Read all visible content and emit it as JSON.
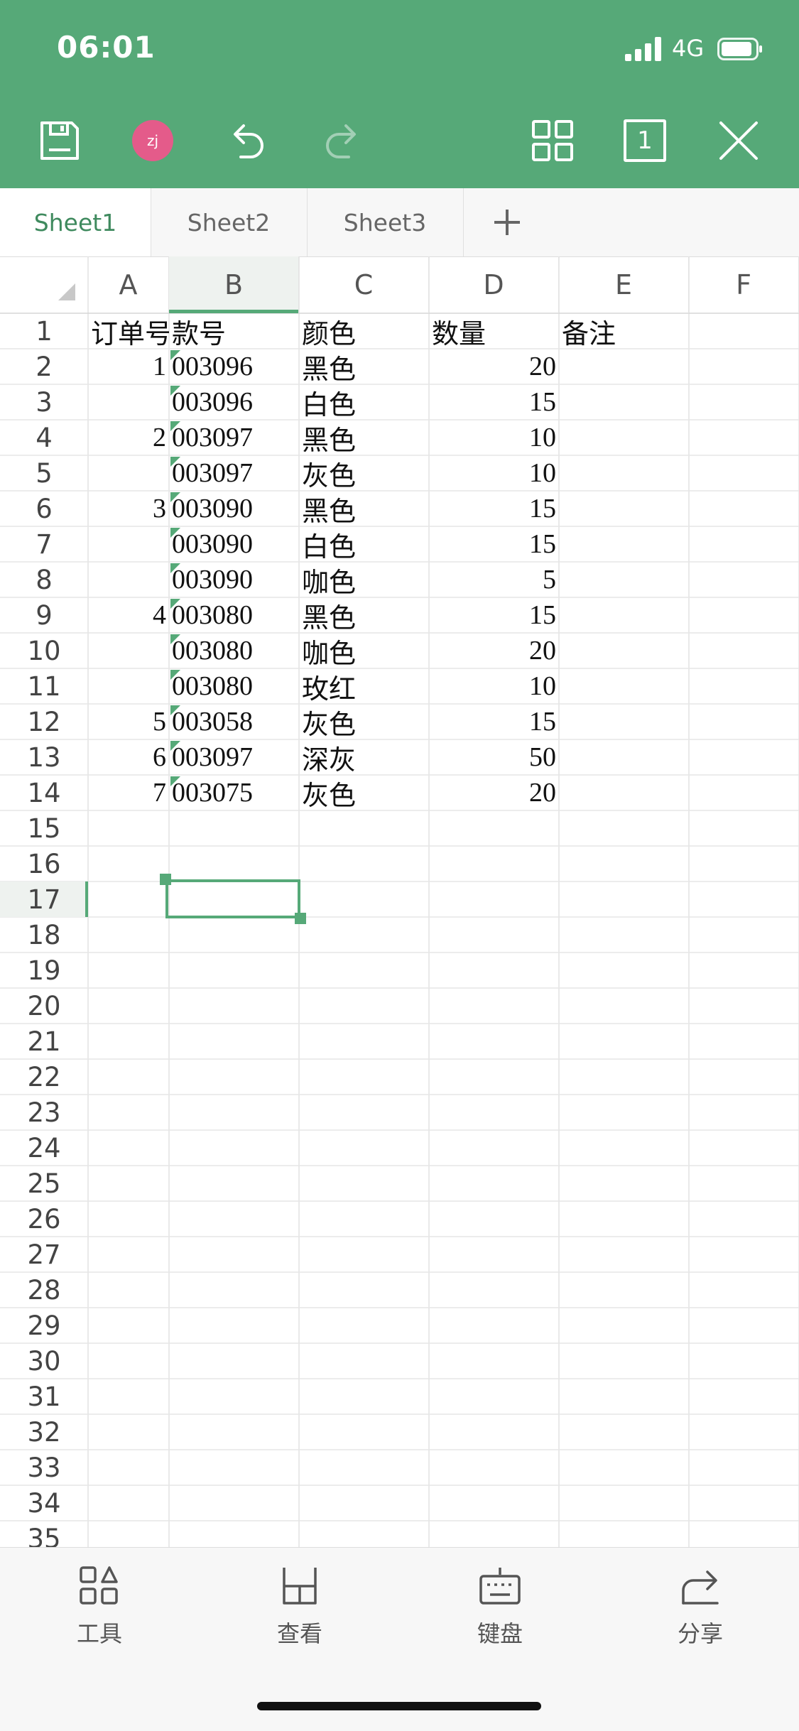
{
  "status_bar": {
    "time": "06:01",
    "network": "4G"
  },
  "toolbar": {
    "avatar_text": "zj",
    "page_number": "1"
  },
  "sheet_tabs": [
    {
      "label": "Sheet1",
      "active": true
    },
    {
      "label": "Sheet2",
      "active": false
    },
    {
      "label": "Sheet3",
      "active": false
    }
  ],
  "columns": [
    "A",
    "B",
    "C",
    "D",
    "E",
    "F"
  ],
  "selected_column": "B",
  "row_numbers": [
    "1",
    "2",
    "3",
    "4",
    "5",
    "6",
    "7",
    "8",
    "9",
    "10",
    "11",
    "12",
    "13",
    "14",
    "15",
    "16",
    "17",
    "18",
    "19",
    "20",
    "21",
    "22",
    "23",
    "24",
    "25",
    "26",
    "27",
    "28",
    "29",
    "30",
    "31",
    "32",
    "33",
    "34",
    "35"
  ],
  "selected_row": "17",
  "table": {
    "headers": [
      "订单号",
      "款号",
      "颜色",
      "数量",
      "备注"
    ],
    "rows": [
      [
        "1",
        "003096",
        "黑色",
        "20",
        ""
      ],
      [
        "",
        "003096",
        "白色",
        "15",
        ""
      ],
      [
        "2",
        "003097",
        "黑色",
        "10",
        ""
      ],
      [
        "",
        "003097",
        "灰色",
        "10",
        ""
      ],
      [
        "3",
        "003090",
        "黑色",
        "15",
        ""
      ],
      [
        "",
        "003090",
        "白色",
        "15",
        ""
      ],
      [
        "",
        "003090",
        "咖色",
        "5",
        ""
      ],
      [
        "4",
        "003080",
        "黑色",
        "15",
        ""
      ],
      [
        "",
        "003080",
        "咖色",
        "20",
        ""
      ],
      [
        "",
        "003080",
        "玫红",
        "10",
        ""
      ],
      [
        "5",
        "003058",
        "灰色",
        "15",
        ""
      ],
      [
        "6",
        "003097",
        "深灰",
        "50",
        ""
      ],
      [
        "7",
        "003075",
        "灰色",
        "20",
        ""
      ]
    ]
  },
  "bottom_bar": {
    "tools": "工具",
    "view": "查看",
    "keyboard": "键盘",
    "share": "分享"
  },
  "colors": {
    "accent": "#56a978",
    "avatar": "#e45b8a"
  }
}
